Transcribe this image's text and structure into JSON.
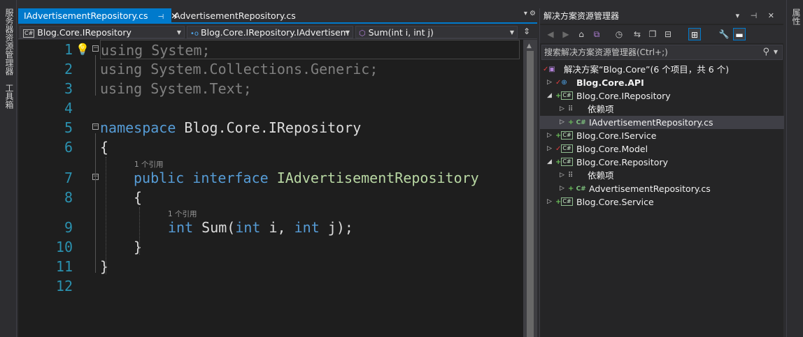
{
  "left_rail": {
    "label1": "服务器资源管理器",
    "label2": "工具箱"
  },
  "right_rail": {
    "label": "属性"
  },
  "editor": {
    "tabs": [
      {
        "label": "IAdvertisementRepository.cs",
        "pin": "⊣",
        "close": "✕",
        "active": true
      },
      {
        "label": "AdvertisementRepository.cs",
        "active": false
      }
    ],
    "tab_tools": "▾ ⚙",
    "nav": {
      "project": "Blog.Core.IRepository",
      "type": "Blog.Core.IRepository.IAdvertisem",
      "member": "Sum(int i, int j)"
    },
    "lines": [
      {
        "num": "1",
        "tokens": [
          [
            "dim",
            "using"
          ],
          [
            "plain",
            " "
          ],
          [
            "dim",
            "System;"
          ]
        ]
      },
      {
        "num": "2",
        "tokens": [
          [
            "dim",
            "using"
          ],
          [
            "plain",
            " "
          ],
          [
            "dim",
            "System.Collections.Generic;"
          ]
        ]
      },
      {
        "num": "3",
        "tokens": [
          [
            "dim",
            "using"
          ],
          [
            "plain",
            " "
          ],
          [
            "dim",
            "System.Text;"
          ]
        ]
      },
      {
        "num": "4",
        "tokens": []
      },
      {
        "num": "5",
        "tokens": [
          [
            "kw",
            "namespace"
          ],
          [
            "plain",
            " Blog.Core.IRepository"
          ]
        ]
      },
      {
        "num": "6",
        "tokens": [
          [
            "plain",
            "{"
          ]
        ]
      },
      {
        "num": "7",
        "tokens": [
          [
            "kw",
            "public"
          ],
          [
            "plain",
            " "
          ],
          [
            "kw",
            "interface"
          ],
          [
            "plain",
            " "
          ],
          [
            "ty",
            "IAdvertisementRepository"
          ]
        ]
      },
      {
        "num": "8",
        "tokens": [
          [
            "plain",
            "{"
          ]
        ]
      },
      {
        "num": "9",
        "tokens": [
          [
            "kw",
            "int"
          ],
          [
            "plain",
            " Sum("
          ],
          [
            "kw",
            "int"
          ],
          [
            "plain",
            " i, "
          ],
          [
            "kw",
            "int"
          ],
          [
            "plain",
            " j);"
          ]
        ]
      },
      {
        "num": "10",
        "tokens": [
          [
            "plain",
            "}"
          ]
        ]
      },
      {
        "num": "11",
        "tokens": [
          [
            "plain",
            "}"
          ]
        ]
      },
      {
        "num": "12",
        "tokens": []
      }
    ],
    "codelens": {
      "interface_refs": "1 个引用",
      "method_refs": "1 个引用"
    }
  },
  "solution_explorer": {
    "title": "解决方案资源管理器",
    "title_tools": "▾ ⊣ ✕",
    "search_placeholder": "搜索解决方案资源管理器(Ctrl+;)",
    "toolbar_icons": [
      "back-icon",
      "forward-icon",
      "home-icon",
      "vs-switch-icon",
      "history-icon",
      "sync-icon",
      "copy-icon",
      "collapse-icon",
      "show-all-icon",
      "properties-icon",
      "preview-icon"
    ],
    "tree": [
      {
        "label": "解决方案“Blog.Core”(6 个项目，共 6 个)",
        "level": 0,
        "kind": "solution",
        "expander": ""
      },
      {
        "label": "Blog.Core.API",
        "level": 1,
        "kind": "web",
        "expander": "▷",
        "bold": true
      },
      {
        "label": "Blog.Core.IRepository",
        "level": 1,
        "kind": "project",
        "expander": "◢"
      },
      {
        "label": "依赖项",
        "level": 2,
        "kind": "deps",
        "expander": "▷"
      },
      {
        "label": "IAdvertisementRepository.cs",
        "level": 2,
        "kind": "csfile",
        "expander": "▷",
        "selected": true
      },
      {
        "label": "Blog.Core.IService",
        "level": 1,
        "kind": "project",
        "expander": "▷"
      },
      {
        "label": "Blog.Core.Model",
        "level": 1,
        "kind": "project-check",
        "expander": "▷"
      },
      {
        "label": "Blog.Core.Repository",
        "level": 1,
        "kind": "project",
        "expander": "◢"
      },
      {
        "label": "依赖项",
        "level": 2,
        "kind": "deps",
        "expander": "▷"
      },
      {
        "label": "AdvertisementRepository.cs",
        "level": 2,
        "kind": "csfile",
        "expander": "▷"
      },
      {
        "label": "Blog.Core.Service",
        "level": 1,
        "kind": "project",
        "expander": "▷"
      }
    ]
  },
  "colors": {
    "accent": "#007acc",
    "keyword": "#569cd6",
    "type": "#b8d7a3",
    "line_number": "#2b91af",
    "dimmed": "#808080"
  }
}
